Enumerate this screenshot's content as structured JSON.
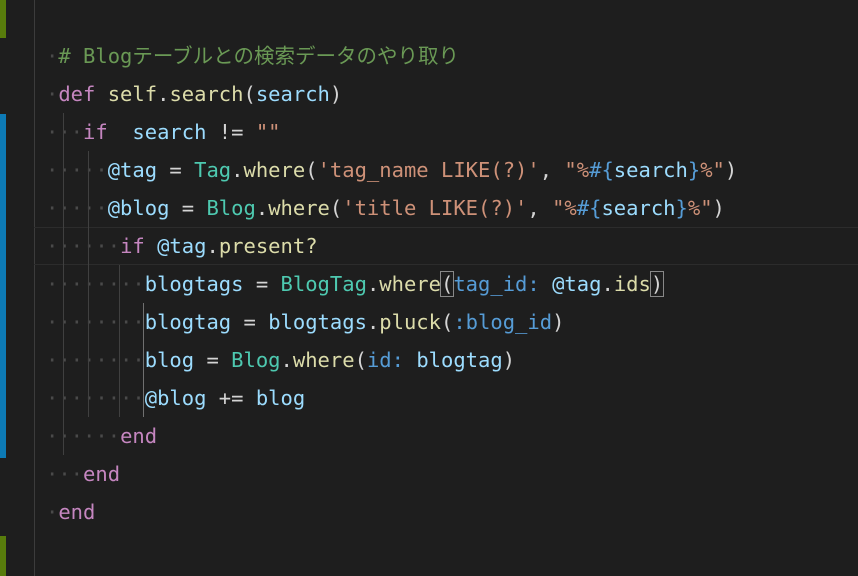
{
  "colors": {
    "background": "#1e1e1e",
    "comment": "#6a9955",
    "keyword": "#c586c0",
    "function": "#dcdcaa",
    "variable": "#9cdcfe",
    "string": "#ce9178",
    "class": "#4ec9b0",
    "symbol": "#569cd6",
    "modified_marker": "#0d7ab5",
    "added_marker": "#587c0c"
  },
  "editor": {
    "active_line": 6,
    "lines": [
      {
        "indent": 1,
        "tokens": [
          {
            "t": "# Blogテーブルとの検索データのやり取り",
            "c": "comment"
          }
        ]
      },
      {
        "indent": 1,
        "tokens": [
          {
            "t": "def",
            "c": "keyword"
          },
          {
            "t": " ",
            "c": "punct"
          },
          {
            "t": "self",
            "c": "function"
          },
          {
            "t": ".",
            "c": "punct"
          },
          {
            "t": "search",
            "c": "function"
          },
          {
            "t": "(",
            "c": "punct"
          },
          {
            "t": "search",
            "c": "variable"
          },
          {
            "t": ")",
            "c": "punct"
          }
        ]
      },
      {
        "indent": 2,
        "tokens": [
          {
            "t": "if",
            "c": "keyword"
          },
          {
            "t": "  ",
            "c": "punct"
          },
          {
            "t": "search",
            "c": "variable"
          },
          {
            "t": " != ",
            "c": "operator"
          },
          {
            "t": "\"\"",
            "c": "string"
          }
        ]
      },
      {
        "indent": 3,
        "tokens": [
          {
            "t": "@tag",
            "c": "variable"
          },
          {
            "t": " = ",
            "c": "operator"
          },
          {
            "t": "Tag",
            "c": "class"
          },
          {
            "t": ".",
            "c": "punct"
          },
          {
            "t": "where",
            "c": "function"
          },
          {
            "t": "(",
            "c": "punct"
          },
          {
            "t": "'tag_name LIKE(?)'",
            "c": "string"
          },
          {
            "t": ", ",
            "c": "punct"
          },
          {
            "t": "\"%",
            "c": "string"
          },
          {
            "t": "#{",
            "c": "interp"
          },
          {
            "t": "search",
            "c": "variable"
          },
          {
            "t": "}",
            "c": "interp"
          },
          {
            "t": "%\"",
            "c": "string"
          },
          {
            "t": ")",
            "c": "punct"
          }
        ]
      },
      {
        "indent": 3,
        "tokens": [
          {
            "t": "@blog",
            "c": "variable"
          },
          {
            "t": " = ",
            "c": "operator"
          },
          {
            "t": "Blog",
            "c": "class"
          },
          {
            "t": ".",
            "c": "punct"
          },
          {
            "t": "where",
            "c": "function"
          },
          {
            "t": "(",
            "c": "punct"
          },
          {
            "t": "'title LIKE(?)'",
            "c": "string"
          },
          {
            "t": ", ",
            "c": "punct"
          },
          {
            "t": "\"%",
            "c": "string"
          },
          {
            "t": "#{",
            "c": "interp"
          },
          {
            "t": "search",
            "c": "variable"
          },
          {
            "t": "}",
            "c": "interp"
          },
          {
            "t": "%\"",
            "c": "string"
          },
          {
            "t": ")",
            "c": "punct"
          }
        ]
      },
      {
        "indent": 3,
        "pad": 0.5,
        "tokens": [
          {
            "t": "if",
            "c": "keyword"
          },
          {
            "t": " ",
            "c": "punct"
          },
          {
            "t": "@tag",
            "c": "variable"
          },
          {
            "t": ".",
            "c": "punct"
          },
          {
            "t": "present?",
            "c": "function"
          }
        ]
      },
      {
        "indent": 4,
        "pad": 0.5,
        "tokens": [
          {
            "t": "blogtags",
            "c": "variable"
          },
          {
            "t": " = ",
            "c": "operator"
          },
          {
            "t": "BlogTag",
            "c": "class"
          },
          {
            "t": ".",
            "c": "punct"
          },
          {
            "t": "where",
            "c": "function"
          },
          {
            "t": "(",
            "c": "punct",
            "match": true
          },
          {
            "t": "tag_id:",
            "c": "symbol"
          },
          {
            "t": " ",
            "c": "punct"
          },
          {
            "t": "@tag",
            "c": "variable"
          },
          {
            "t": ".",
            "c": "punct"
          },
          {
            "t": "ids",
            "c": "function"
          },
          {
            "t": ")",
            "c": "punct",
            "match": true
          }
        ]
      },
      {
        "indent": 4,
        "pad": 0.5,
        "tokens": [
          {
            "t": "blogtag",
            "c": "variable"
          },
          {
            "t": " = ",
            "c": "operator"
          },
          {
            "t": "blogtags",
            "c": "variable"
          },
          {
            "t": ".",
            "c": "punct"
          },
          {
            "t": "pluck",
            "c": "function"
          },
          {
            "t": "(",
            "c": "punct"
          },
          {
            "t": ":blog_id",
            "c": "symbol"
          },
          {
            "t": ")",
            "c": "punct"
          }
        ]
      },
      {
        "indent": 4,
        "pad": 0.5,
        "tokens": [
          {
            "t": "blog",
            "c": "variable"
          },
          {
            "t": " = ",
            "c": "operator"
          },
          {
            "t": "Blog",
            "c": "class"
          },
          {
            "t": ".",
            "c": "punct"
          },
          {
            "t": "where",
            "c": "function"
          },
          {
            "t": "(",
            "c": "punct"
          },
          {
            "t": "id:",
            "c": "symbol"
          },
          {
            "t": " ",
            "c": "punct"
          },
          {
            "t": "blogtag",
            "c": "variable"
          },
          {
            "t": ")",
            "c": "punct"
          }
        ]
      },
      {
        "indent": 4,
        "pad": 0.5,
        "tokens": [
          {
            "t": "@blog",
            "c": "variable"
          },
          {
            "t": " += ",
            "c": "operator"
          },
          {
            "t": "blog",
            "c": "variable"
          }
        ]
      },
      {
        "indent": 3,
        "pad": 0.5,
        "tokens": [
          {
            "t": "end",
            "c": "keyword"
          }
        ]
      },
      {
        "indent": 2,
        "tokens": [
          {
            "t": "end",
            "c": "keyword"
          }
        ]
      },
      {
        "indent": 1,
        "tokens": [
          {
            "t": "end",
            "c": "keyword"
          }
        ]
      }
    ]
  }
}
